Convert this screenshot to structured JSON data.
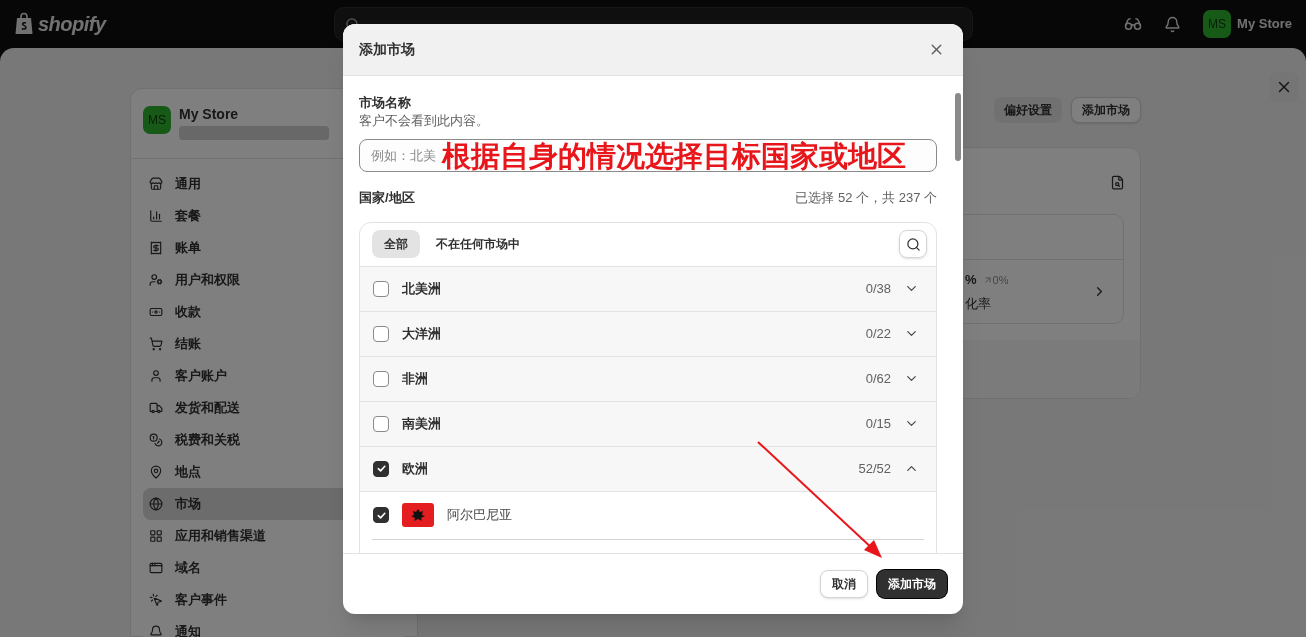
{
  "top_bar": {
    "logo": "shopify",
    "store": {
      "avatar": "MS",
      "name": "My Store"
    }
  },
  "settings": {
    "store": {
      "avatar": "MS",
      "name": "My Store"
    },
    "nav": [
      {
        "label": "通用",
        "selected": false
      },
      {
        "label": "套餐",
        "selected": false
      },
      {
        "label": "账单",
        "selected": false
      },
      {
        "label": "用户和权限",
        "selected": false
      },
      {
        "label": "收款",
        "selected": false
      },
      {
        "label": "结账",
        "selected": false
      },
      {
        "label": "客户账户",
        "selected": false
      },
      {
        "label": "发货和配送",
        "selected": false
      },
      {
        "label": "税费和关税",
        "selected": false
      },
      {
        "label": "地点",
        "selected": false
      },
      {
        "label": "市场",
        "selected": true
      },
      {
        "label": "应用和销售渠道",
        "selected": false
      },
      {
        "label": "域名",
        "selected": false
      },
      {
        "label": "客户事件",
        "selected": false
      },
      {
        "label": "通知",
        "selected": false
      }
    ],
    "actions": [
      {
        "label": "偏好设置",
        "kind": "plain"
      },
      {
        "label": "添加市场",
        "kind": "outlined"
      }
    ],
    "metric": {
      "value": "%",
      "change": "0%",
      "label": "化率"
    }
  },
  "modal": {
    "title": "添加市场",
    "name_field": {
      "label": "市场名称",
      "hint": "客户不会看到此内容。",
      "placeholder": "例如：北美"
    },
    "annotation": "根据自身的情况选择目标国家或地区",
    "regions": {
      "label": "国家/地区",
      "summary": "已选择 52 个，共 237 个"
    },
    "filters": [
      {
        "label": "全部",
        "selected": true
      },
      {
        "label": "不在任何市场中",
        "selected": false
      }
    ],
    "groups": [
      {
        "name": "北美洲",
        "count": "0/38",
        "checked": false,
        "expanded": false
      },
      {
        "name": "大洋洲",
        "count": "0/22",
        "checked": false,
        "expanded": false
      },
      {
        "name": "非洲",
        "count": "0/62",
        "checked": false,
        "expanded": false
      },
      {
        "name": "南美洲",
        "count": "0/15",
        "checked": false,
        "expanded": false
      },
      {
        "name": "欧洲",
        "count": "52/52",
        "checked": true,
        "expanded": true,
        "children": [
          {
            "name": "阿尔巴尼亚",
            "checked": true
          }
        ]
      }
    ],
    "buttons": [
      {
        "label": "取消",
        "kind": "secondary"
      },
      {
        "label": "添加市场",
        "kind": "primary"
      }
    ]
  }
}
